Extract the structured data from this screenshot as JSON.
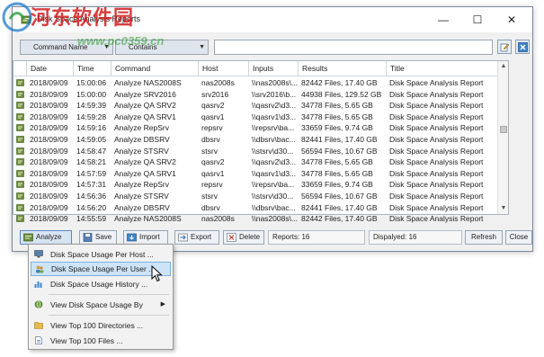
{
  "window": {
    "title": "Disk Space Analysis Reports"
  },
  "watermark": {
    "text": "河东软件园",
    "url": "www.pc0359.cn"
  },
  "filter": {
    "field": "Command Name",
    "operator": "Contains",
    "value": ""
  },
  "columns": [
    "Date",
    "Time",
    "Command",
    "Host",
    "Inputs",
    "Results",
    "Title"
  ],
  "rows": [
    [
      "2018/09/09",
      "15:00:06",
      "Analyze NAS2008S",
      "nas2008s",
      "\\\\nas2008s\\...",
      "82442 Files, 17.40 GB",
      "Disk Space Analysis Report"
    ],
    [
      "2018/09/09",
      "15:00:00",
      "Analyze SRV2016",
      "srv2016",
      "\\\\srv2016\\b...",
      "44938 Files, 129.52 GB",
      "Disk Space Analysis Report"
    ],
    [
      "2018/09/09",
      "14:59:39",
      "Analyze QA SRV2",
      "qasrv2",
      "\\\\qasrv2\\d3...",
      "34778 Files, 5.65 GB",
      "Disk Space Analysis Report"
    ],
    [
      "2018/09/09",
      "14:59:28",
      "Analyze QA SRV1",
      "qasrv1",
      "\\\\qasrv1\\d3...",
      "34778 Files, 5.65 GB",
      "Disk Space Analysis Report"
    ],
    [
      "2018/09/09",
      "14:59:16",
      "Analyze RepSrv",
      "repsrv",
      "\\\\repsrv\\ba...",
      "33659 Files, 9.74 GB",
      "Disk Space Analysis Report"
    ],
    [
      "2018/09/09",
      "14:59:05",
      "Analyze DBSRV",
      "dbsrv",
      "\\\\dbsrv\\bac...",
      "82441 Files, 17.40 GB",
      "Disk Space Analysis Report"
    ],
    [
      "2018/09/09",
      "14:58:47",
      "Analyze STSRV",
      "stsrv",
      "\\\\stsrv\\d30...",
      "56594 Files, 10.67 GB",
      "Disk Space Analysis Report"
    ],
    [
      "2018/09/09",
      "14:58:21",
      "Analyze QA SRV2",
      "qasrv2",
      "\\\\qasrv2\\d3...",
      "34778 Files, 5.65 GB",
      "Disk Space Analysis Report"
    ],
    [
      "2018/09/09",
      "14:57:59",
      "Analyze QA SRV1",
      "qasrv1",
      "\\\\qasrv1\\d3...",
      "34778 Files, 5.65 GB",
      "Disk Space Analysis Report"
    ],
    [
      "2018/09/09",
      "14:57:31",
      "Analyze RepSrv",
      "repsrv",
      "\\\\repsrv\\ba...",
      "33659 Files, 9.74 GB",
      "Disk Space Analysis Report"
    ],
    [
      "2018/09/09",
      "14:56:36",
      "Analyze STSRV",
      "stsrv",
      "\\\\stsrv\\d30...",
      "56594 Files, 10.67 GB",
      "Disk Space Analysis Report"
    ],
    [
      "2018/09/09",
      "14:56:20",
      "Analyze DBSRV",
      "dbsrv",
      "\\\\dbsrv\\bac...",
      "82441 Files, 17.40 GB",
      "Disk Space Analysis Report"
    ],
    [
      "2018/09/09",
      "14:55:59",
      "Analyze NAS2008S",
      "nas2008s",
      "\\\\nas2008s\\...",
      "82442 Files, 17.40 GB",
      "Disk Space Analysis Report"
    ]
  ],
  "toolbar": {
    "analyze": "Analyze",
    "save": "Save",
    "import": "Import",
    "export": "Export",
    "delete": "Delete",
    "reports": "Reports: 16",
    "displayed": "Dispalyed: 16",
    "refresh": "Refresh",
    "close": "Close"
  },
  "menu": {
    "items": [
      "Disk Space Usage Per Host ...",
      "Disk Space Usage Per User ...",
      "Disk Space Usage History ...",
      "View Disk Space Usage By",
      "View Top 100 Directories ...",
      "View Top 100 Files ..."
    ],
    "hovered_index": 1
  },
  "colors": {
    "accent": "#5a88c2",
    "menu_hover": "#cde4f7",
    "watermark_red": "#d01414"
  }
}
